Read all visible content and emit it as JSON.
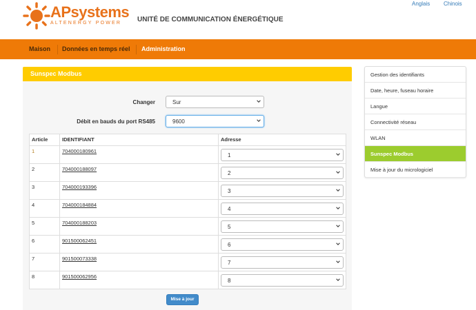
{
  "header": {
    "brand": "APsystems",
    "brand_sub": "ALTENERGY POWER",
    "site_title": "UNITÉ DE COMMUNICATION ÉNERGÉTIQUE",
    "languages": [
      "Anglais",
      "Chinois"
    ]
  },
  "nav": {
    "items": [
      "Maison",
      "Données en temps réel",
      "Administration"
    ],
    "active": "Administration"
  },
  "panel": {
    "title": "Sunspec Modbus",
    "change_label": "Changer",
    "change_value": "Sur",
    "baud_label": "Débit en bauds du port RS485",
    "baud_value": "9600"
  },
  "table": {
    "headers": [
      "Article",
      "IDENTIFIANT",
      "Adresse"
    ],
    "rows": [
      {
        "article": "1",
        "id": "704000180961",
        "address": "1"
      },
      {
        "article": "2",
        "id": "704000188097",
        "address": "2"
      },
      {
        "article": "3",
        "id": "704000193396",
        "address": "3"
      },
      {
        "article": "4",
        "id": "704000184884",
        "address": "4"
      },
      {
        "article": "5",
        "id": "704000188203",
        "address": "5"
      },
      {
        "article": "6",
        "id": "901500062451",
        "address": "6"
      },
      {
        "article": "7",
        "id": "901500073338",
        "address": "7"
      },
      {
        "article": "8",
        "id": "901500062956",
        "address": "8"
      }
    ]
  },
  "update_button": "Mise à jour",
  "sidebar": {
    "items": [
      "Gestion des identifiants",
      "Date, heure, fuseau horaire",
      "Langue",
      "Connectivité réseau",
      "WLAN",
      "Sunspec Modbus",
      "Mise à jour du micrologiciel"
    ],
    "active": "Sunspec Modbus"
  },
  "colors": {
    "brand_orange": "#ef7a07",
    "panel_yellow": "#ffcc00",
    "sidebar_active": "#9ccc2e",
    "button_blue": "#428bca"
  }
}
